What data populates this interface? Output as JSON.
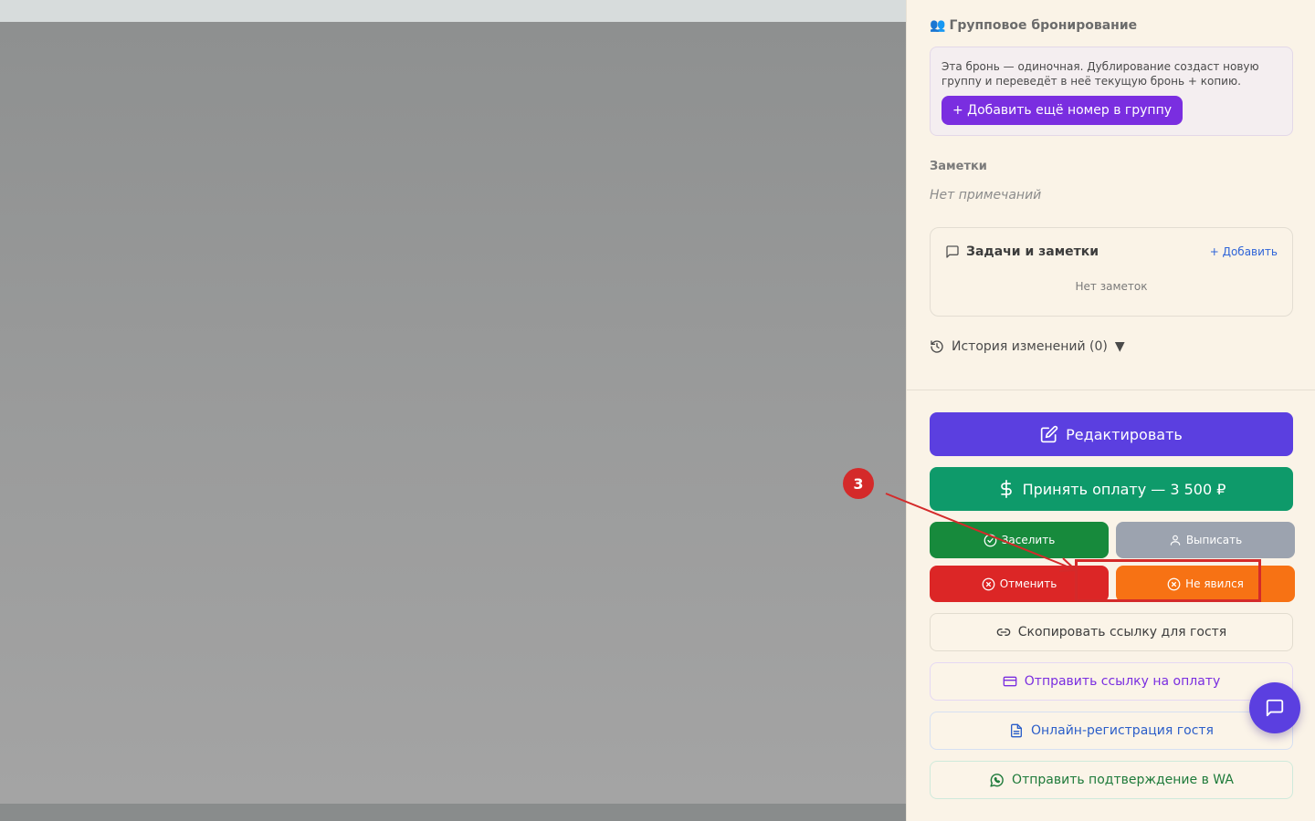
{
  "panel": {
    "group": {
      "emoji": "👥",
      "title": "Групповое бронирование",
      "text": "Эта бронь — одиночная. Дублирование создаст новую группу и переведёт в неё текущую бронь + копию.",
      "add_label": "+ Добавить ещё номер в группу"
    },
    "notes": {
      "title": "Заметки",
      "empty": "Нет примечаний"
    },
    "tasks": {
      "title": "Задачи и заметки",
      "add_label": "+ Добавить",
      "empty": "Нет заметок"
    },
    "history": {
      "label": "История изменений (0)",
      "caret": "▼"
    },
    "actions": {
      "edit": "Редактировать",
      "pay": "Принять оплату — 3 500 ₽",
      "checkin": "Заселить",
      "checkout": "Выписать",
      "cancel": "Отменить",
      "noshow": "Не явился",
      "copy_link": "Скопировать ссылку для гостя",
      "pay_link": "Отправить ссылку на оплату",
      "online_reg": "Онлайн-регистрация гостя",
      "wa_confirm": "Отправить подтверждение в WA"
    }
  },
  "annotation": {
    "marker": "3"
  },
  "colors": {
    "edit": "#5b3fe0",
    "pay": "#0e9a6a",
    "checkin": "#178a3c",
    "checkout": "#9ca3af",
    "cancel": "#dc2626",
    "noshow": "#f77214",
    "annotation": "#d42a2a"
  },
  "icons": {
    "group": "people-emoji",
    "tasks": "chat-bubble-icon",
    "history": "history-icon",
    "edit": "pencil-square-icon",
    "pay": "dollar-icon",
    "checkin": "check-circle-icon",
    "checkout": "user-icon",
    "cancel": "x-circle-icon",
    "noshow": "x-circle-icon",
    "copy": "link-icon",
    "paylink": "credit-card-icon",
    "reg": "document-icon",
    "wa": "whatsapp-icon",
    "chat": "chat-bubble-icon"
  }
}
